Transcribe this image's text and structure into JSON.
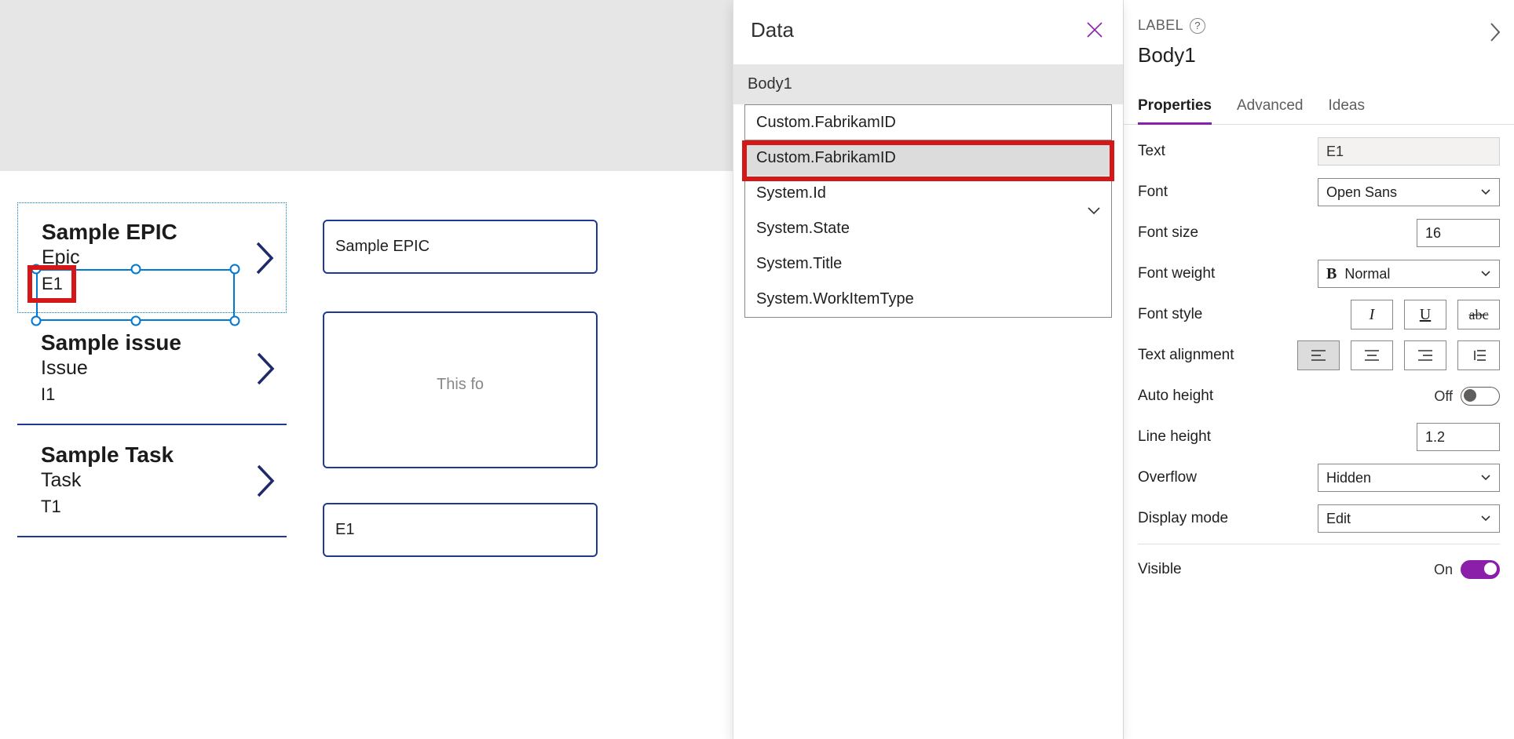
{
  "canvas": {
    "cards": [
      {
        "title": "Sample EPIC",
        "type": "Epic",
        "body": "E1"
      },
      {
        "title": "Sample issue",
        "type": "Issue",
        "body": "I1"
      },
      {
        "title": "Sample Task",
        "type": "Task",
        "body": "T1"
      }
    ],
    "detail": {
      "title_text": "Sample EPIC",
      "placeholder2": "This fo",
      "body_text": "E1"
    }
  },
  "data_panel": {
    "title": "Data",
    "target_label": "Body1",
    "selected_field": "Custom.FabrikamID",
    "options": [
      "Custom.FabrikamID",
      "System.Id",
      "System.State",
      "System.Title",
      "System.WorkItemType"
    ]
  },
  "props_panel": {
    "section": "LABEL",
    "control_name": "Body1",
    "tabs": [
      "Properties",
      "Advanced",
      "Ideas"
    ],
    "rows": {
      "text": {
        "label": "Text",
        "value": "E1"
      },
      "font": {
        "label": "Font",
        "value": "Open Sans"
      },
      "font_size": {
        "label": "Font size",
        "value": "16"
      },
      "font_weight": {
        "label": "Font weight",
        "value": "Normal"
      },
      "font_style": {
        "label": "Font style"
      },
      "text_align": {
        "label": "Text alignment"
      },
      "auto_height": {
        "label": "Auto height",
        "value": "Off"
      },
      "line_height": {
        "label": "Line height",
        "value": "1.2"
      },
      "overflow": {
        "label": "Overflow",
        "value": "Hidden"
      },
      "display_mode": {
        "label": "Display mode",
        "value": "Edit"
      },
      "visible": {
        "label": "Visible",
        "value": "On"
      }
    }
  }
}
